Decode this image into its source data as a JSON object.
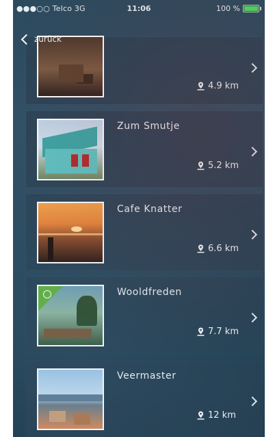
{
  "status_bar": {
    "carrier": "●●●○○ Telco  3G",
    "time": "11:06",
    "battery": "100 %"
  },
  "nav": {
    "back_label": "zurück"
  },
  "items": [
    {
      "name": "",
      "distance": "4.9 km",
      "thumbnail": "restaurant-interior"
    },
    {
      "name": "Zum Smutje",
      "distance": "5.2 km",
      "thumbnail": "teal-house"
    },
    {
      "name": "Cafe Knatter",
      "distance": "6.6 km",
      "thumbnail": "sunset-sea"
    },
    {
      "name": "Wooldfreden",
      "distance": "7.7 km",
      "thumbnail": "garden-terrace"
    },
    {
      "name": "Veermaster",
      "distance": "12 km",
      "thumbnail": "harbor-terrace"
    }
  ],
  "colors": {
    "background": "#2b4a5e",
    "card": "#284254",
    "battery": "#4cd964"
  }
}
